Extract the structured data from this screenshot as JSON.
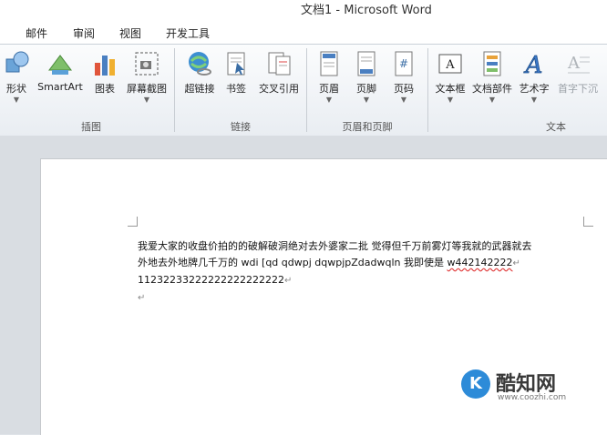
{
  "window": {
    "title": "文档1 - Microsoft Word"
  },
  "tabs": [
    "邮件",
    "审阅",
    "视图",
    "开发工具"
  ],
  "ribbon": {
    "groups": [
      {
        "label": "插图",
        "buttons": [
          {
            "label": "形状",
            "icon": "shapes-icon"
          },
          {
            "label": "SmartArt",
            "icon": "smartart-icon"
          },
          {
            "label": "图表",
            "icon": "chart-icon"
          },
          {
            "label": "屏幕截图",
            "icon": "screenshot-icon"
          }
        ]
      },
      {
        "label": "链接",
        "buttons": [
          {
            "label": "超链接",
            "icon": "hyperlink-icon"
          },
          {
            "label": "书签",
            "icon": "bookmark-icon"
          },
          {
            "label": "交叉引用",
            "icon": "cross-reference-icon"
          }
        ]
      },
      {
        "label": "页眉和页脚",
        "buttons": [
          {
            "label": "页眉",
            "icon": "header-icon"
          },
          {
            "label": "页脚",
            "icon": "footer-icon"
          },
          {
            "label": "页码",
            "icon": "page-number-icon"
          }
        ]
      },
      {
        "label": "文本",
        "buttons": [
          {
            "label": "文本框",
            "icon": "textbox-icon"
          },
          {
            "label": "文档部件",
            "icon": "quick-parts-icon"
          },
          {
            "label": "艺术字",
            "icon": "wordart-icon"
          },
          {
            "label": "首字下沉",
            "icon": "drop-cap-icon"
          }
        ]
      }
    ]
  },
  "document": {
    "line1": "我爱大家的收盘价拍的的破解破洞绝对去外婆家二批 觉得但千万前雾灯等我就的武器就去",
    "line2_pre": "外地去外地牌几千万的 wdi [qd qdwpj dqwpjpZdadwqln 我即使是 ",
    "line2_squig": "w442142222",
    "line3": "11232233222222222222222",
    "para_mark": "↵"
  },
  "watermark": {
    "brand": "酷知网",
    "logo": "K",
    "url": "www.coozhi.com"
  }
}
